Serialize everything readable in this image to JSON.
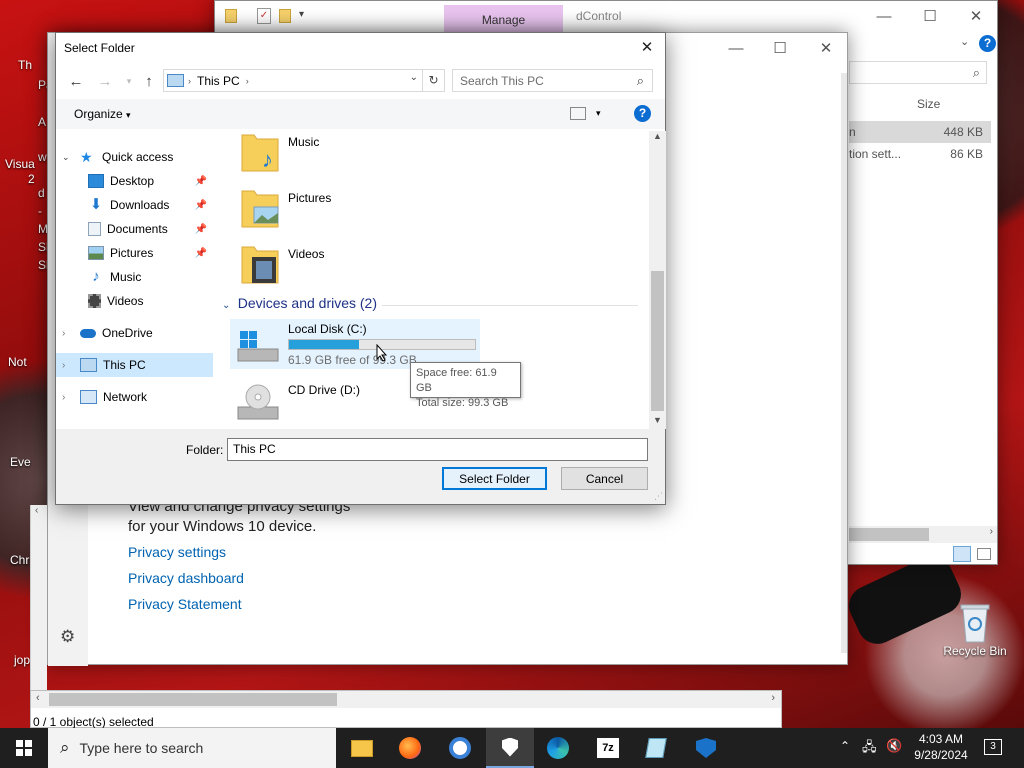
{
  "desktop": {
    "icons": [
      {
        "label": "Recycle Bin"
      }
    ],
    "cut_labels": [
      "Th",
      "Pa",
      "Visua",
      "2",
      "Not",
      "Eve",
      "Chr",
      "jop",
      "A",
      "w",
      "d",
      "-",
      "Mi",
      "Sl",
      "Sl"
    ]
  },
  "explorer_back": {
    "tab_manage": "Manage",
    "title_fragment": "dControl",
    "column_size": "Size",
    "rows": [
      {
        "name": "n",
        "size": "448 KB"
      },
      {
        "name": "tion sett...",
        "size": "86 KB"
      }
    ],
    "status": "0 / 1 object(s) selected"
  },
  "settings_back": {
    "text_line1": "View and change privacy settings",
    "text_line2": "for your Windows 10 device.",
    "links": [
      "Privacy settings",
      "Privacy dashboard",
      "Privacy Statement"
    ]
  },
  "dialog": {
    "title": "Select Folder",
    "address_path": "This PC",
    "search_placeholder": "Search This PC",
    "organize_label": "Organize",
    "tree": [
      {
        "label": "Quick access",
        "icon": "star-icon"
      },
      {
        "label": "Desktop",
        "icon": "desktop-icon"
      },
      {
        "label": "Downloads",
        "icon": "download-icon"
      },
      {
        "label": "Documents",
        "icon": "document-icon"
      },
      {
        "label": "Pictures",
        "icon": "picture-icon"
      },
      {
        "label": "Music",
        "icon": "music-icon"
      },
      {
        "label": "Videos",
        "icon": "video-icon"
      },
      {
        "label": "OneDrive",
        "icon": "cloud-icon"
      },
      {
        "label": "This PC",
        "icon": "computer-icon"
      },
      {
        "label": "Network",
        "icon": "network-icon"
      }
    ],
    "folders": [
      {
        "label": "Music"
      },
      {
        "label": "Pictures"
      },
      {
        "label": "Videos"
      }
    ],
    "devices_header": "Devices and drives (2)",
    "drives": [
      {
        "label": "Local Disk (C:)",
        "free_text": "61.9 GB free of 99.3 GB",
        "used_fraction": 0.377
      },
      {
        "label": "CD Drive (D:)"
      }
    ],
    "tooltip": {
      "line1": "Space free: 61.9 GB",
      "line2": "Total size: 99.3 GB"
    },
    "folder_label": "Folder:",
    "folder_value": "This PC",
    "select_button": "Select Folder",
    "cancel_button": "Cancel"
  },
  "taskbar": {
    "search_placeholder": "Type here to search",
    "time": "4:03 AM",
    "date": "9/28/2024",
    "notification_count": "3",
    "apps": [
      "file-explorer-icon",
      "firefox-icon",
      "chrome-icon",
      "security-icon",
      "edge-icon",
      "7zip-icon",
      "notepad-icon",
      "dcontrol-icon"
    ]
  },
  "colors": {
    "accent": "#0078d7",
    "selection": "#cce8ff",
    "progress": "#26a0da"
  }
}
